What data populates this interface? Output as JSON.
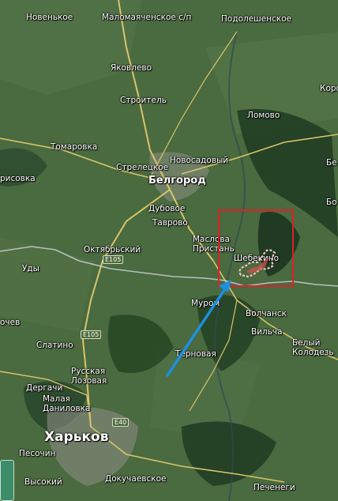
{
  "map": {
    "colors": {
      "terrain": "#4a6a3f",
      "forest": "#1f3a22",
      "road": "#d8c46a",
      "border": "#c9cfd4",
      "box": "#e0202a",
      "arrow": "#1d8fe0",
      "fire": "#f3c7c7"
    },
    "labels": {
      "novenkoye": "Новенькое",
      "malomayachenskoye": "Маломаяченское с/п",
      "podolesheskoye": "Подолешенское",
      "yakovlevo": "Яковлево",
      "korocha": "Коро",
      "stroitel": "Строитель",
      "lomovo": "Ломово",
      "tomarovka": "Томаровка",
      "novosadovy": "Новосадовый",
      "streletskoye": "Стрелецкое",
      "belgorod": "Белгород",
      "borisovka": "рисовка",
      "bel_edge": "Бе",
      "dubovoye": "Дубовое",
      "tavrovo": "Таврово",
      "bol_edge": "Бо",
      "oktyabrsky": "Октябрьский",
      "maslova_pristan": "Маслова\nПристань",
      "shebekino": "Шебекино",
      "udy": "Уды",
      "murom": "Муром",
      "volchansk": "Волчанск",
      "vilcha": "Вильча",
      "ochev": "очев",
      "slatino": "Слатино",
      "belyi_kolodez": "Белый\nКолодезь",
      "ternovaya": "Терновая",
      "russkaya_lozovaya": "Русская\nЛозовая",
      "dergachi": "Дергачи",
      "malaya_danilovka": "Малая\nДаниловка",
      "kharkov": "Харьков",
      "pesochin": "Песочин",
      "vysokiy": "Высокий",
      "dokuchaevskoye": "Докучаевское",
      "pechenegi": "Печенеги",
      "e105_a": "E105",
      "e105_b": "E105",
      "e40": "E40"
    }
  }
}
